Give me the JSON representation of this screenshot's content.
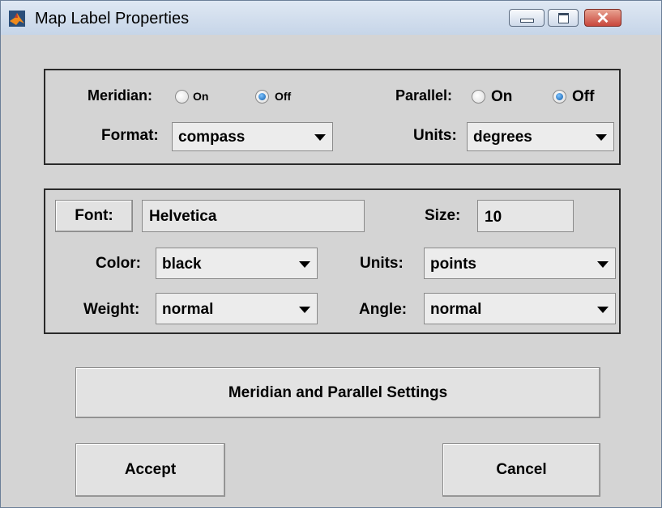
{
  "window": {
    "title": "Map Label Properties",
    "icon": "matlab-icon",
    "close_glyph": "✕"
  },
  "grid_labels": {
    "meridian_label": "Meridian:",
    "meridian_on": "On",
    "meridian_off": "Off",
    "meridian_selected": "Off",
    "parallel_label": "Parallel:",
    "parallel_on": "On",
    "parallel_off": "Off",
    "parallel_selected": "Off",
    "format_label": "Format:",
    "format_value": "compass",
    "units_label": "Units:",
    "units_value": "degrees"
  },
  "font_settings": {
    "font_button": "Font:",
    "font_value": "Helvetica",
    "size_label": "Size:",
    "size_value": "10",
    "color_label": "Color:",
    "color_value": "black",
    "units_label": "Units:",
    "units_value": "points",
    "weight_label": "Weight:",
    "weight_value": "normal",
    "angle_label": "Angle:",
    "angle_value": "normal"
  },
  "buttons": {
    "settings": "Meridian and Parallel Settings",
    "accept": "Accept",
    "cancel": "Cancel"
  },
  "colors": {
    "titlebar": "#c6d5e8",
    "client_bg": "#d4d4d4",
    "radio_selected": "#0d5aa8",
    "close_button": "#c9473c"
  }
}
